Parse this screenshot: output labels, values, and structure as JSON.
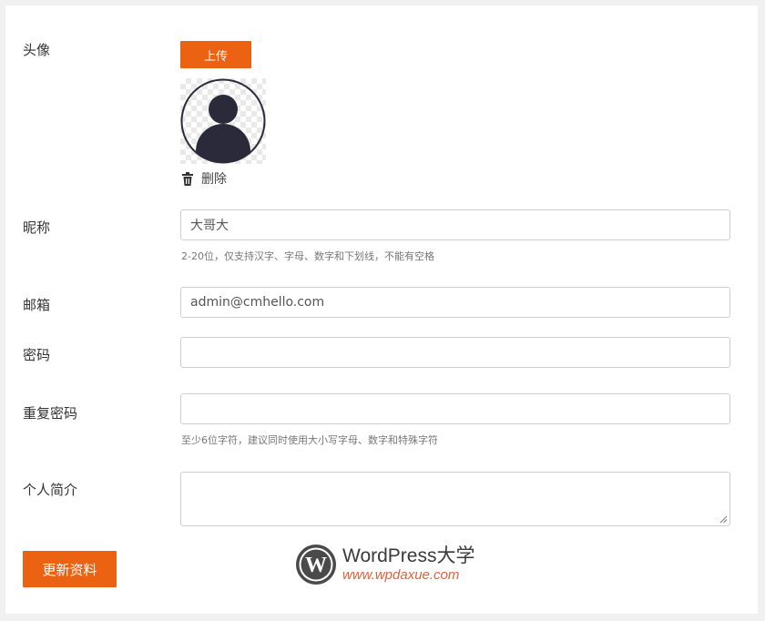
{
  "avatar": {
    "label": "头像",
    "upload_label": "上传",
    "delete_label": "删除"
  },
  "nickname": {
    "label": "昵称",
    "value": "大哥大",
    "hint": "2-20位，仅支持汉字、字母、数字和下划线，不能有空格"
  },
  "email": {
    "label": "邮箱",
    "value": "admin@cmhello.com"
  },
  "password": {
    "label": "密码",
    "value": ""
  },
  "repeat_password": {
    "label": "重复密码",
    "value": "",
    "hint": "至少6位字符，建议同时使用大小写字母、数字和特殊字符"
  },
  "bio": {
    "label": "个人简介",
    "value": ""
  },
  "submit_label": "更新资料",
  "watermark": {
    "title": "WordPress大学",
    "url": "www.wpdaxue.com"
  },
  "colors": {
    "accent": "#ea6212",
    "avatar_fill": "#2b2a3a"
  }
}
